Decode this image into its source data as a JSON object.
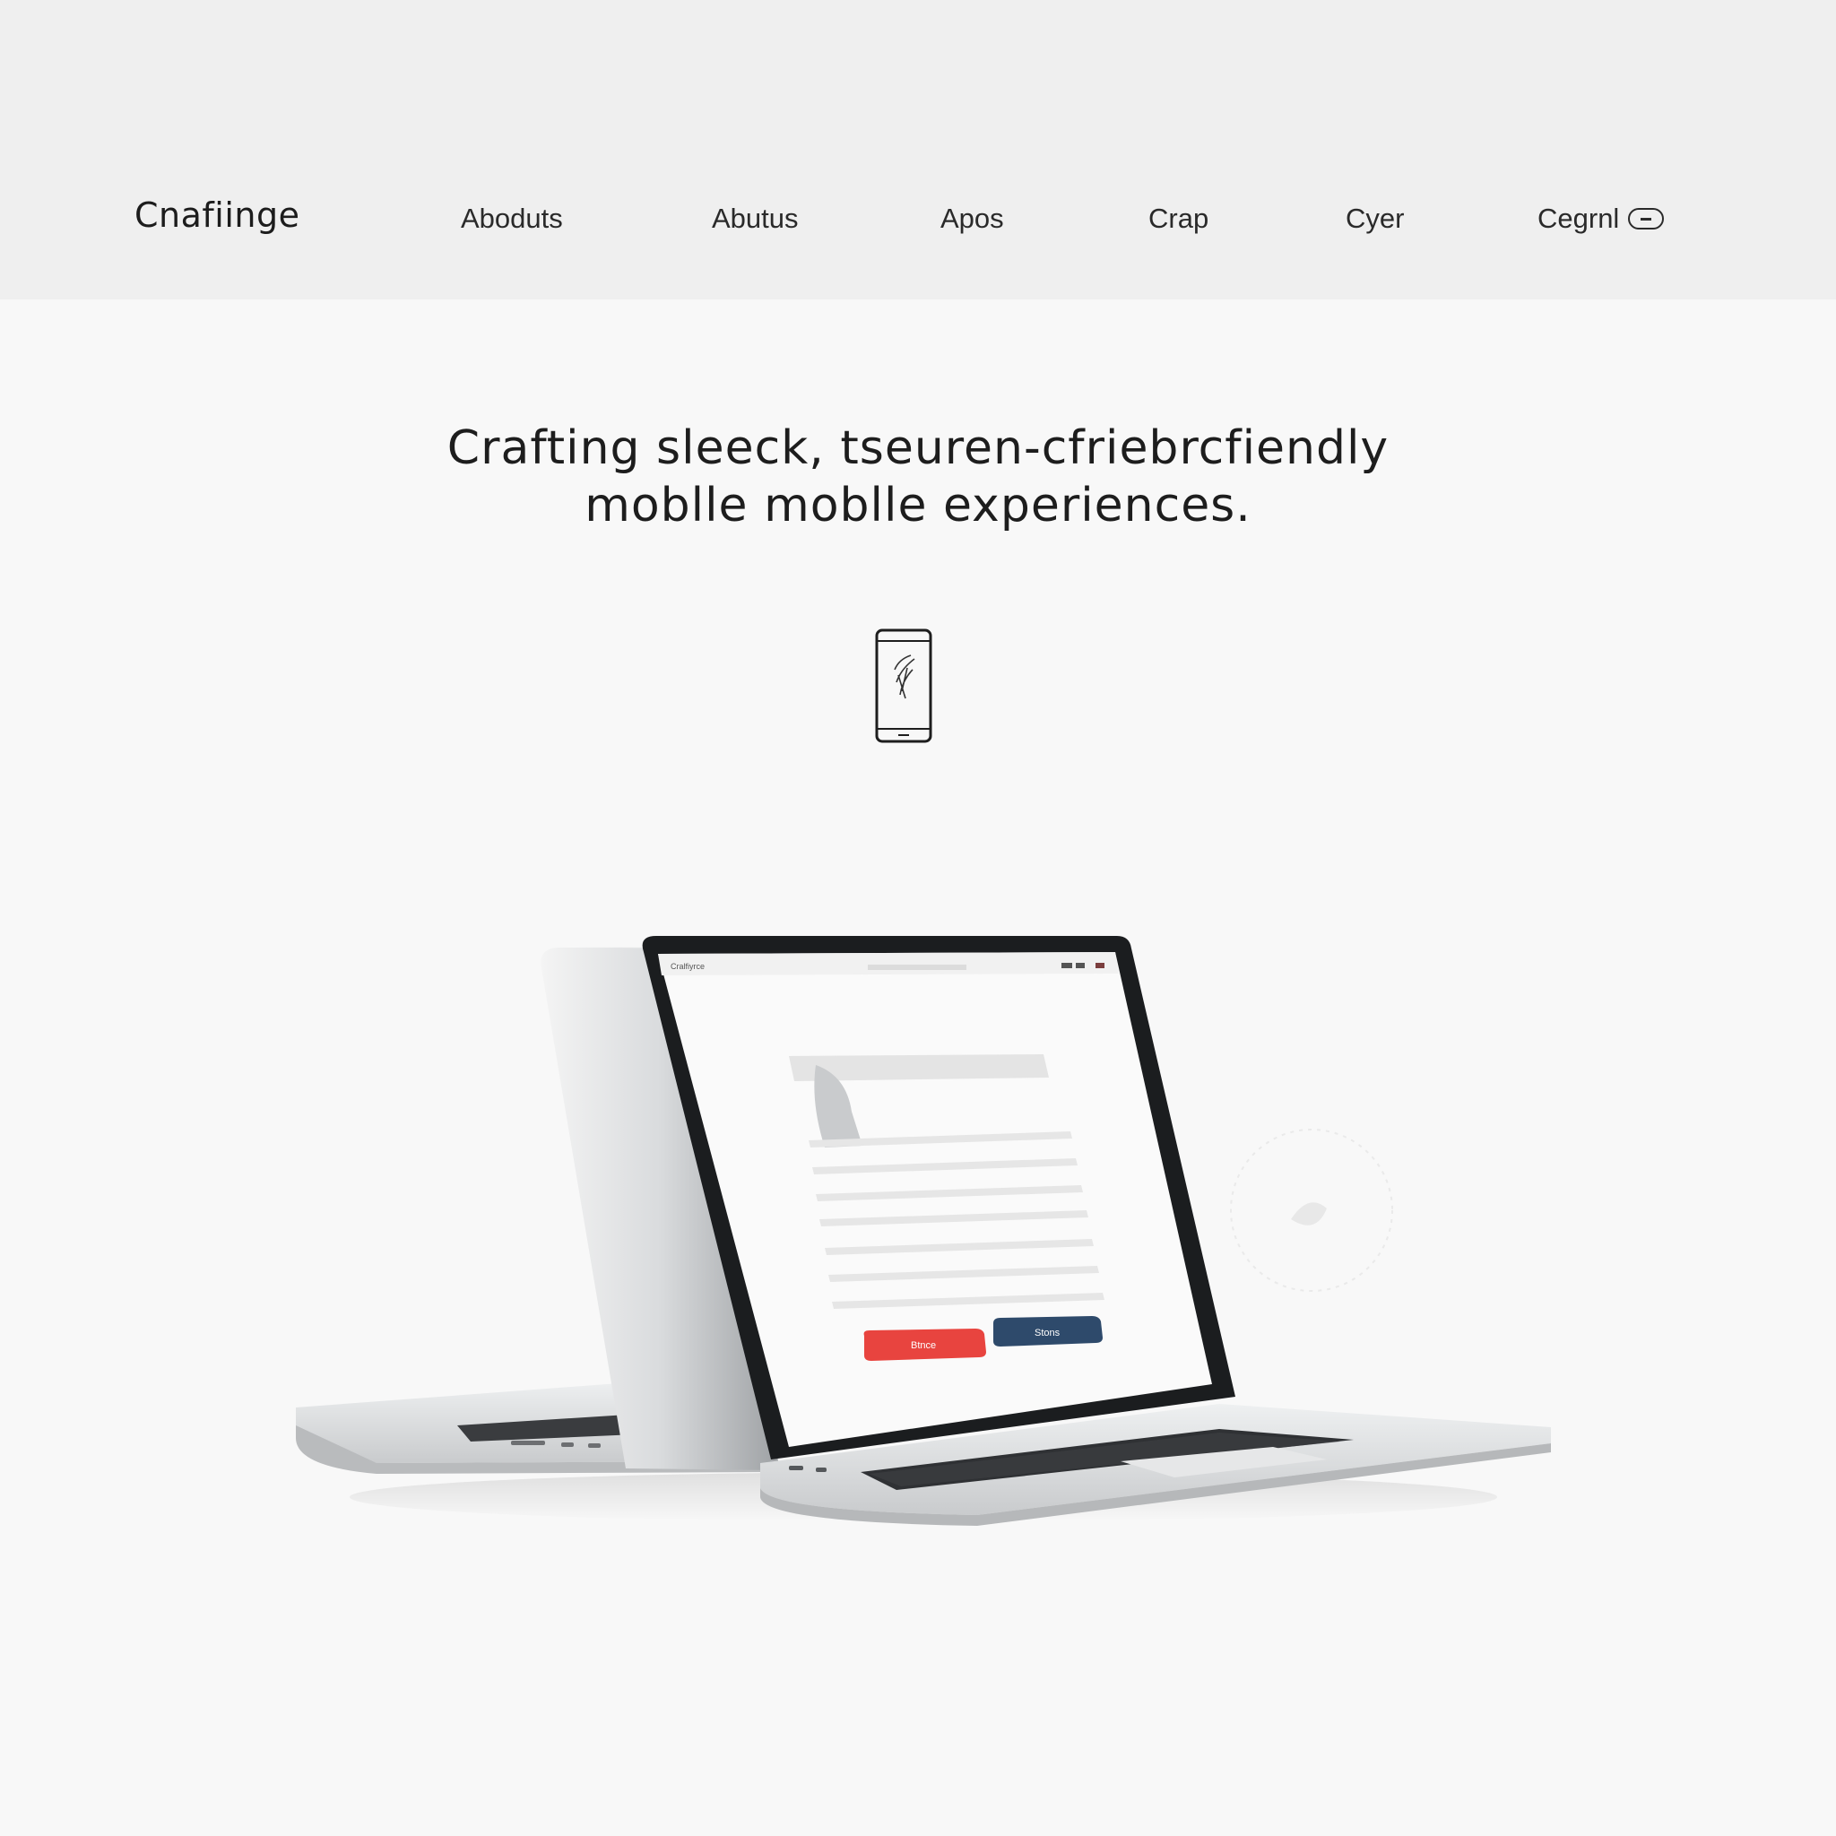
{
  "header": {
    "brand": "Cnafiinge",
    "nav": [
      {
        "label": "Aboduts"
      },
      {
        "label": "Abutus"
      },
      {
        "label": "Apos"
      },
      {
        "label": "Crap"
      },
      {
        "label": "Cyer"
      },
      {
        "label": "Cegrnl"
      }
    ]
  },
  "hero": {
    "line1": "Crafting sleeck, tseuren-cfriebrcfiendly",
    "line2": "moblle moblle experiences."
  },
  "colors": {
    "header_bg": "#efefef",
    "page_bg": "#f8f8f8",
    "accent_red": "#e8443f",
    "accent_navy": "#2e4a6b",
    "text": "#1d1d1d"
  },
  "icons": {
    "hero": "mobile-phone-icon",
    "cta": "pill-minus-icon"
  }
}
